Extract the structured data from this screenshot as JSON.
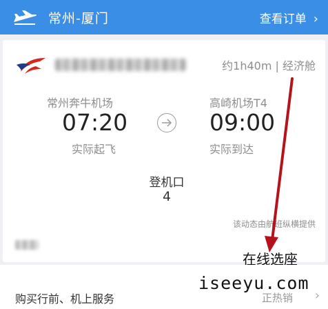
{
  "header": {
    "route": "常州-厦门",
    "order_link": "查看订单",
    "chevron": "›",
    "plane_icon": "plane-icon"
  },
  "flight": {
    "airline_logo": "china-eastern-logo",
    "meta": "约1h40m | 经济舱",
    "departure": {
      "airport": "常州奔牛机场",
      "time": "07:20",
      "status": "实际起飞"
    },
    "arrival": {
      "airport": "高崎机场T4",
      "time": "09:00",
      "status": "实际到达"
    },
    "gate": {
      "label": "登机口",
      "value": "4"
    },
    "source_note": "该动态由航班纵横提供"
  },
  "annotation": {
    "text": "在线选座",
    "arrow_color": "#b5121b"
  },
  "services": {
    "title": "购买行前、机上服务",
    "hot_label": "正热销",
    "chevron": "›"
  },
  "watermark": "iseeyu.com",
  "colors": {
    "header": "#3a8ee6",
    "logo_red": "#d7261e",
    "logo_blue": "#1f3c88"
  }
}
